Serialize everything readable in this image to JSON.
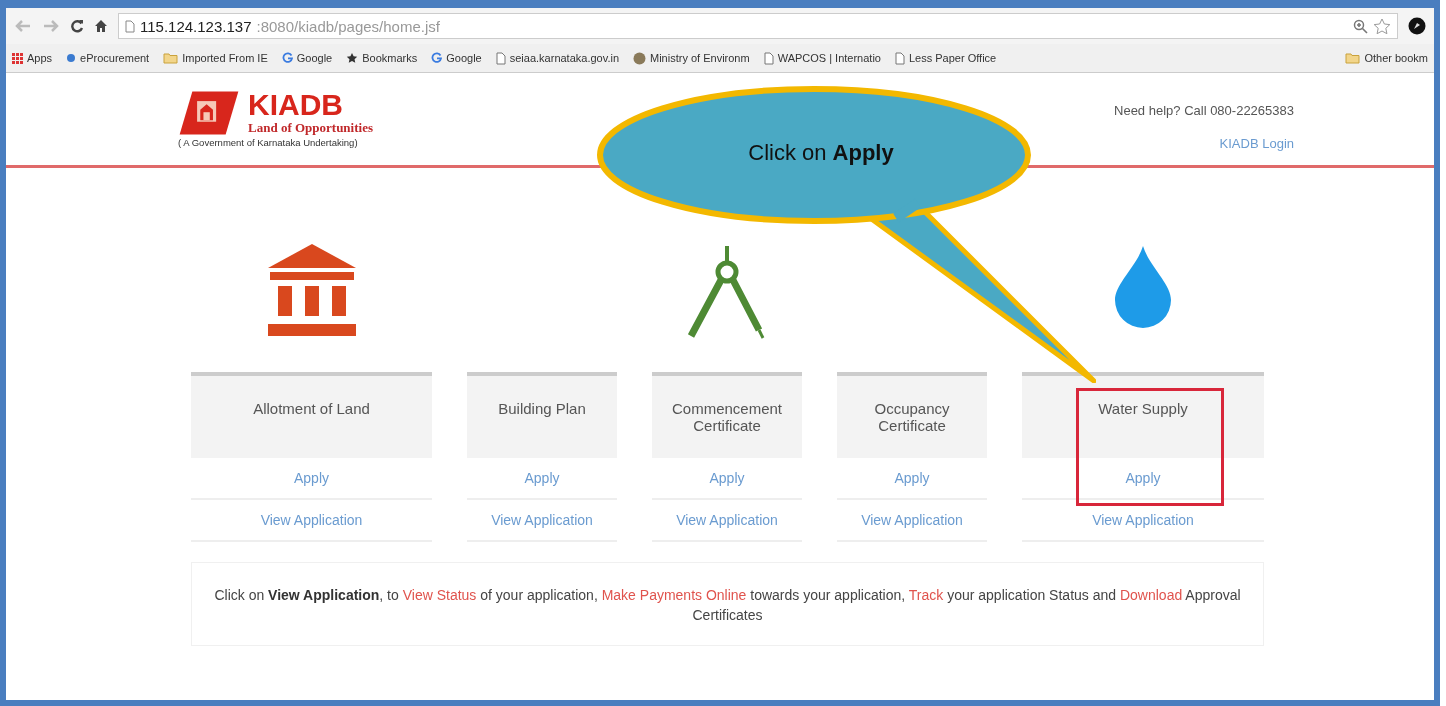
{
  "browser": {
    "url_host": "115.124.123.137",
    "url_path": ":8080/kiadb/pages/home.jsf"
  },
  "bookmarks": [
    {
      "label": "Apps",
      "kind": "apps"
    },
    {
      "label": "eProcurement",
      "kind": "dot"
    },
    {
      "label": "Imported From IE",
      "kind": "folder"
    },
    {
      "label": "Google",
      "kind": "google"
    },
    {
      "label": "Bookmarks",
      "kind": "star"
    },
    {
      "label": "Google",
      "kind": "google"
    },
    {
      "label": "seiaa.karnataka.gov.in",
      "kind": "page"
    },
    {
      "label": "Ministry of Environm",
      "kind": "globe"
    },
    {
      "label": "WAPCOS | Internatio",
      "kind": "page"
    },
    {
      "label": "Less Paper Office",
      "kind": "page"
    }
  ],
  "other_bookmarks": "Other bookm",
  "header": {
    "logo_title": "KIADB",
    "logo_tagline": "Land of Opportunities",
    "logo_subtitle": "( A Government of Karnataka Undertaking)",
    "help": "Need help? Call 080-22265383",
    "login": "KIADB Login"
  },
  "services": [
    {
      "title": "Allotment of Land",
      "kind": "bank",
      "apply": "Apply",
      "view": "View Application",
      "highlighted": false
    },
    {
      "title": "Building Plan",
      "apply": "Apply",
      "view": "View Application",
      "highlighted": false
    },
    {
      "title": "Commencement Certificate",
      "kind": "compass",
      "apply": "Apply",
      "view": "View Application",
      "highlighted": false
    },
    {
      "title": "Occupancy Certificate",
      "apply": "Apply",
      "view": "View Application",
      "highlighted": false
    },
    {
      "title": "Water Supply",
      "kind": "drop",
      "apply": "Apply",
      "view": "View Application",
      "highlighted": true
    }
  ],
  "note": [
    {
      "text": "Click on ",
      "kind": "plain"
    },
    {
      "text": "View Application",
      "kind": "bold"
    },
    {
      "text": ", to ",
      "kind": "plain"
    },
    {
      "text": "View Status",
      "kind": "link"
    },
    {
      "text": " of your application, ",
      "kind": "plain"
    },
    {
      "text": "Make Payments Online",
      "kind": "link"
    },
    {
      "text": " towards your application, ",
      "kind": "plain"
    },
    {
      "text": "Track",
      "kind": "link"
    },
    {
      "text": " your application Status and ",
      "kind": "plain"
    },
    {
      "text": "Download",
      "kind": "link"
    },
    {
      "text": " Approval Certificates",
      "kind": "plain"
    }
  ],
  "callout": {
    "text": "Click on **Apply**"
  }
}
